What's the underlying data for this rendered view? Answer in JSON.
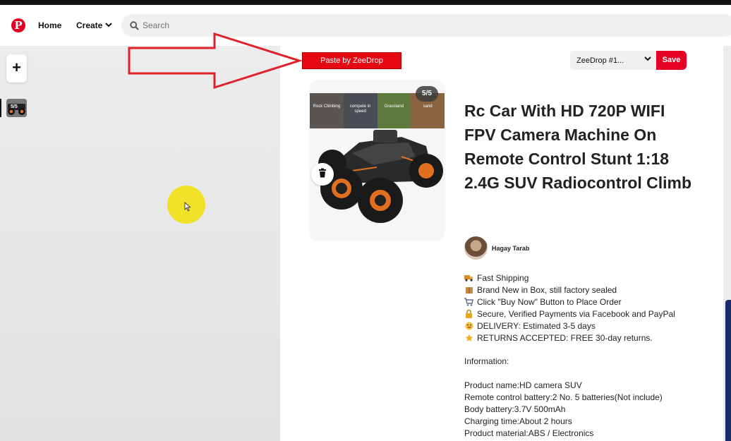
{
  "header": {
    "home_label": "Home",
    "create_label": "Create",
    "search_placeholder": "Search",
    "brand_color": "#e60023"
  },
  "sidebar": {
    "add_label": "+",
    "thumb_badge": "5/5"
  },
  "editor": {
    "paste_button_label": "Paste by ZeeDrop",
    "board_select_value": "ZeeDrop #1...",
    "save_label": "Save",
    "image_counter": "5/5",
    "image_strip": [
      "Rock Climbing",
      "compete in speed",
      "Grassland",
      "sand"
    ],
    "title": "Rc Car With HD 720P WIFI FPV Camera Machine On Remote Control Stunt 1:18 2.4G SUV Radiocontrol Climb",
    "author": "Hagay Tarab",
    "description": {
      "features": [
        {
          "icon": "truck-icon",
          "text": "Fast Shipping"
        },
        {
          "icon": "package-icon",
          "text": "Brand New in Box, still factory sealed"
        },
        {
          "icon": "cart-icon",
          "text": "Click \"Buy Now\" Button to Place Order"
        },
        {
          "icon": "lock-icon",
          "text": "Secure, Verified Payments via Facebook and PayPal"
        },
        {
          "icon": "smile-icon",
          "text": "DELIVERY: Estimated 3-5 days"
        },
        {
          "icon": "star-icon",
          "text": "RETURNS ACCEPTED: FREE 30-day returns."
        }
      ],
      "info_heading": "Information:",
      "specs": [
        "Product name:HD camera SUV",
        "Remote control battery:2 No. 5 batteries(Not include)",
        "Body battery:3.7V 500mAh",
        "Charging time:About 2 hours",
        "Product material:ABS / Electronics"
      ]
    }
  },
  "annotation": {
    "arrow_color": "#e0202a",
    "cursor_highlight_color": "#f1e21f"
  }
}
